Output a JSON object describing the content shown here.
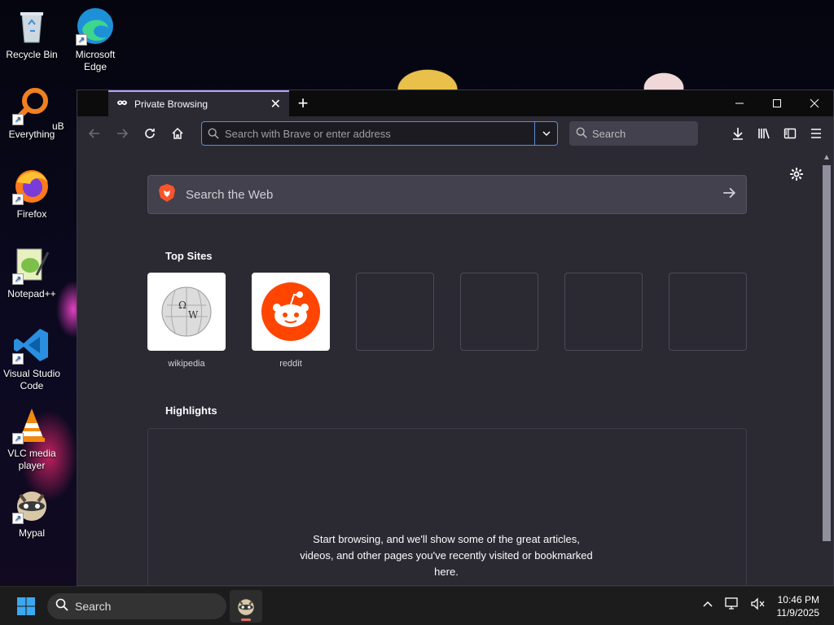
{
  "desktop": {
    "icons": [
      {
        "label": "Recycle Bin",
        "icon": "recycle-bin-icon"
      },
      {
        "label": "Microsoft Edge",
        "icon": "edge-icon"
      },
      {
        "label": "Everything",
        "icon": "everything-icon"
      },
      {
        "label": "Firefox",
        "icon": "firefox-icon"
      },
      {
        "label": "Notepad++",
        "icon": "notepadpp-icon"
      },
      {
        "label": "Visual Studio Code",
        "icon": "vscode-icon"
      },
      {
        "label": "VLC media player",
        "icon": "vlc-icon"
      },
      {
        "label": "Mypal",
        "icon": "mypal-icon"
      }
    ],
    "partial_label": "uB"
  },
  "browser": {
    "tab_title": "Private Browsing",
    "address_placeholder": "Search with Brave or enter address",
    "search_placeholder": "Search",
    "web_search_label": "Search the Web",
    "top_sites_title": "Top Sites",
    "top_sites": [
      {
        "label": "wikipedia",
        "icon": "wikipedia-icon"
      },
      {
        "label": "reddit",
        "icon": "reddit-icon"
      },
      {
        "label": ""
      },
      {
        "label": ""
      },
      {
        "label": ""
      },
      {
        "label": ""
      }
    ],
    "highlights_title": "Highlights",
    "highlights_message": "Start browsing, and we'll show some of the great articles, videos, and other pages you've recently visited or bookmarked here."
  },
  "taskbar": {
    "search_label": "Search",
    "time": "10:46 PM",
    "date": "11/9/2025"
  },
  "colors": {
    "accent": "#b4a2ff",
    "urlbar_focus": "#5b8ed8",
    "brave": "#fb542b",
    "reddit": "#ff4500"
  }
}
